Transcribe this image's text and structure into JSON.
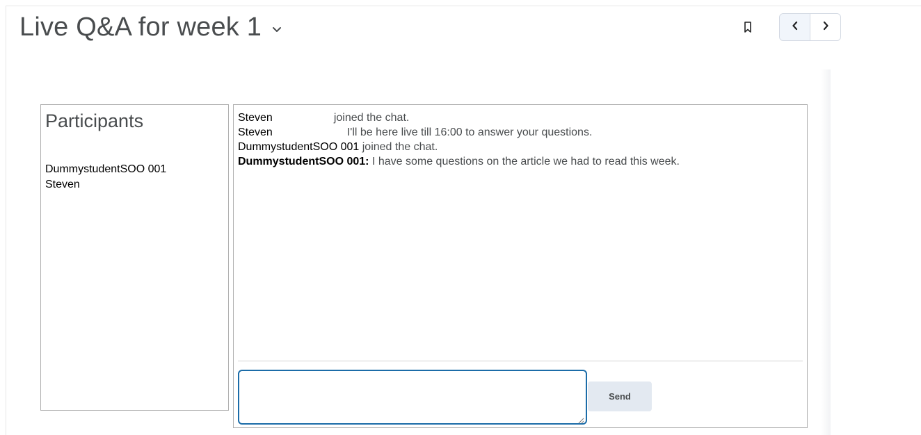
{
  "header": {
    "title": "Live Q&A for week 1"
  },
  "icons": {
    "title_dropdown": "chevron-down-icon",
    "bookmark": "bookmark-icon",
    "prev": "chevron-left-icon",
    "next": "chevron-right-icon"
  },
  "participants": {
    "title": "Participants",
    "items": [
      "DummystudentSOO 001",
      "Steven"
    ]
  },
  "chat": {
    "messages": [
      {
        "author": "Steven",
        "text": "joined the chat."
      },
      {
        "author": "Steven",
        "text": "I'll be here live till 16:00 to answer your questions."
      },
      {
        "author": "DummystudentSOO 001",
        "text": "joined the chat."
      },
      {
        "author": "DummystudentSOO 001:",
        "text": "I have some questions on the article we had to read this week."
      }
    ],
    "input_value": "",
    "send_label": "Send"
  },
  "colors": {
    "input_border": "#1b6ca8",
    "send_bg": "#e3e9f1",
    "title_text": "#494c4e"
  }
}
